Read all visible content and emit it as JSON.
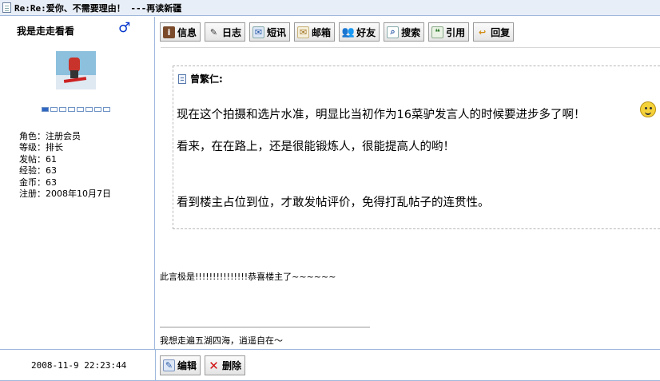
{
  "title_bar": {
    "title": "Re:Re:爱你、不需要理由！ ---再读新疆"
  },
  "user": {
    "name": "我是走走看看",
    "gender_symbol": "♂",
    "level_segments_total": 8,
    "level_segments_filled": 1,
    "info": [
      {
        "label": "角色",
        "value": "注册会员"
      },
      {
        "label": "等级",
        "value": "排长"
      },
      {
        "label": "发帖",
        "value": "61"
      },
      {
        "label": "经验",
        "value": "63"
      },
      {
        "label": "金币",
        "value": "63"
      },
      {
        "label": "注册",
        "value": "2008年10月7日"
      }
    ]
  },
  "toolbar": {
    "buttons": [
      {
        "label": "信息",
        "icon": "info-icon"
      },
      {
        "label": "日志",
        "icon": "pen-icon"
      },
      {
        "label": "短讯",
        "icon": "message-icon"
      },
      {
        "label": "邮箱",
        "icon": "mail-icon"
      },
      {
        "label": "好友",
        "icon": "friends-icon"
      },
      {
        "label": "搜索",
        "icon": "search-doc-icon"
      },
      {
        "label": "引用",
        "icon": "quote-icon"
      },
      {
        "label": "回复",
        "icon": "reply-icon"
      }
    ]
  },
  "quote": {
    "author": "曾繁仁:",
    "lines": [
      "现在这个拍摄和选片水准，明显比当初作为16菜驴发言人的时候要进步多了啊！",
      "看来，在在路上，还是很能锻炼人，很能提高人的哟！",
      "",
      "看到楼主占位到位，才敢发帖评价，免得打乱帖子的连贯性。"
    ],
    "emoji": "smiley-icon"
  },
  "reply": {
    "text": "此言极是!!!!!!!!!!!!!!!恭喜楼主了~~~~~~"
  },
  "signature": {
    "text": "我想走遍五湖四海，逍遥自在～"
  },
  "footer": {
    "post_time": "2008-11-9 22:23:44",
    "edit_label": "编辑",
    "delete_label": "删除"
  },
  "colors": {
    "border": "#9fb8dc",
    "titlebar_bg": "#e8eef7",
    "gender_blue": "#0033cc",
    "delete_red": "#d01010"
  }
}
